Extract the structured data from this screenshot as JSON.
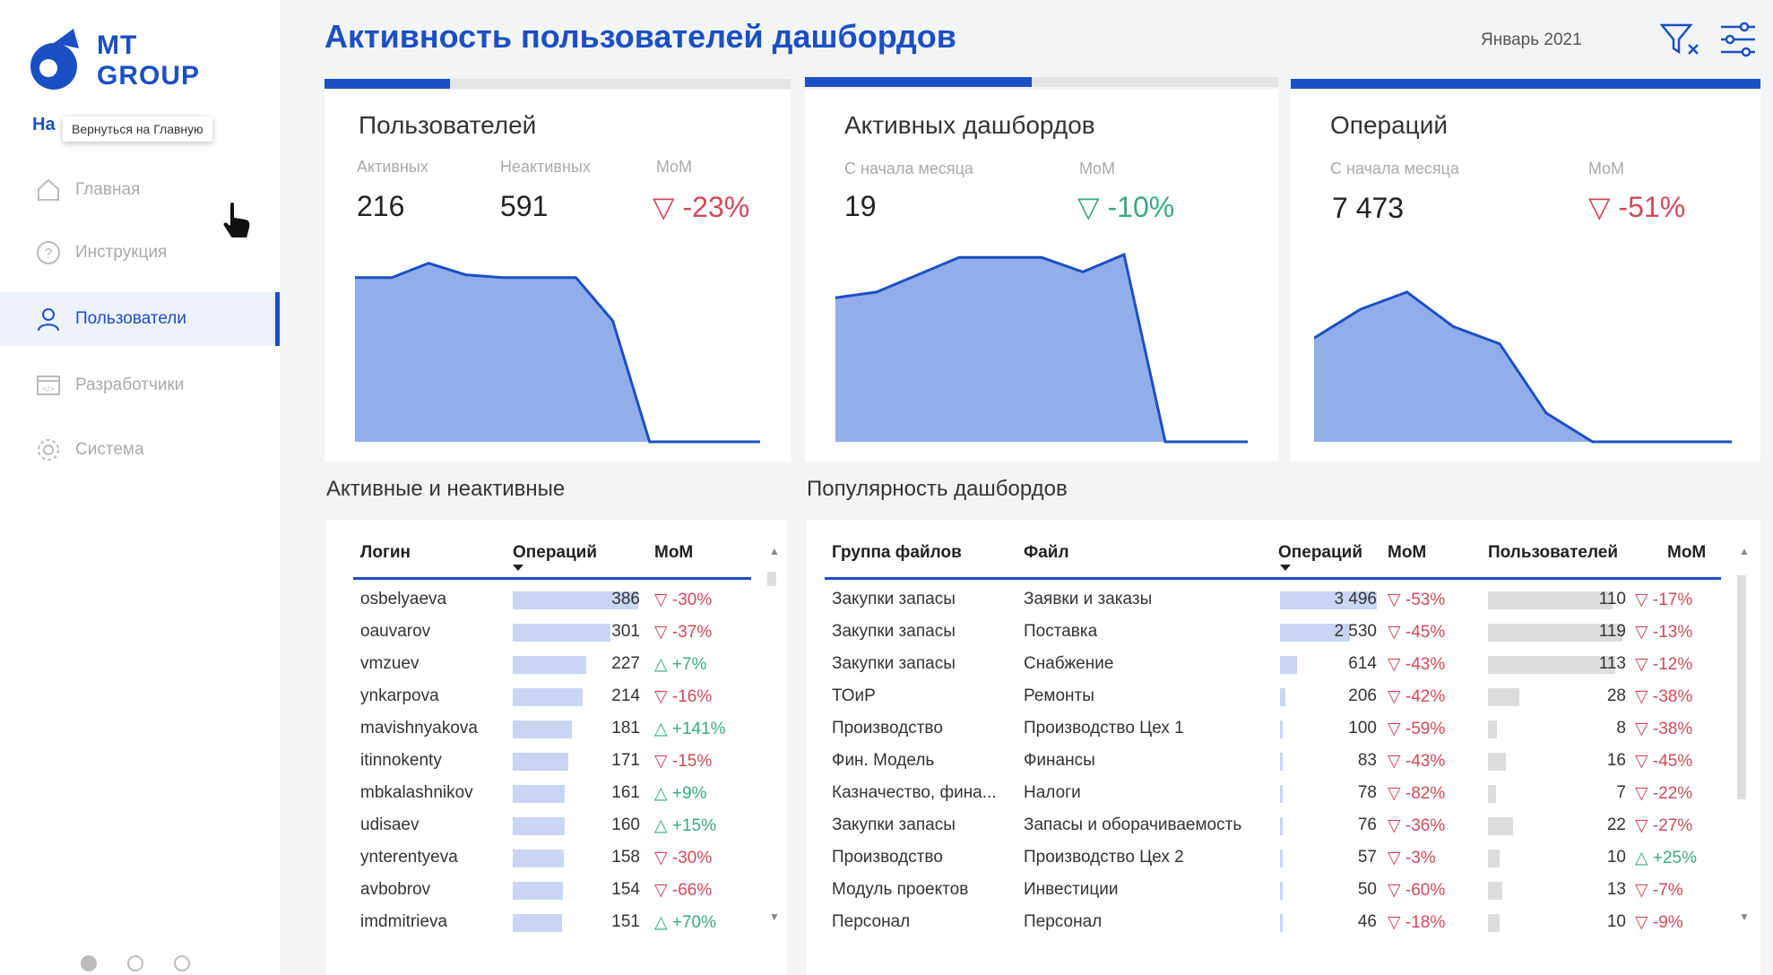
{
  "brand": {
    "line1": "MT",
    "line2": "GROUP",
    "color": "#1b4fc4"
  },
  "sidebar": {
    "home_short": "На",
    "tooltip": "Вернуться на Главную",
    "items": [
      {
        "label": "Главная",
        "icon": "home-icon"
      },
      {
        "label": "Инструкция",
        "icon": "help-icon"
      },
      {
        "label": "Пользователи",
        "icon": "user-icon",
        "active": true
      },
      {
        "label": "Разработчики",
        "icon": "code-icon"
      },
      {
        "label": "Система",
        "icon": "gear-icon"
      }
    ],
    "page_dots": {
      "count": 3,
      "active_index": 0
    }
  },
  "header": {
    "title": "Активность пользователей дашбордов",
    "period": "Январь 2021",
    "icons": [
      "clear-filter-icon",
      "settings-sliders-icon"
    ]
  },
  "cards": [
    {
      "title": "Пользователей",
      "progress": 0.27,
      "labels": [
        "Активных",
        "Неактивных",
        "MoM"
      ],
      "values": [
        "216",
        "591"
      ],
      "mom": "▽ -23%",
      "mom_dir": "down",
      "series": [
        57,
        57,
        62,
        58,
        57,
        57,
        57,
        42,
        0,
        0,
        0,
        0
      ]
    },
    {
      "title": "Активных дашбордов",
      "progress": 0.48,
      "labels": [
        "С начала месяца",
        "MoM"
      ],
      "values": [
        "19"
      ],
      "mom": "▽ -10%",
      "mom_dir": "down",
      "series": [
        50,
        52,
        58,
        64,
        64,
        64,
        59,
        65,
        0,
        0,
        0
      ]
    },
    {
      "title": "Операций",
      "progress": 1.0,
      "labels": [
        "С начала месяца",
        "MoM"
      ],
      "values": [
        "7 473"
      ],
      "mom": "▽ -51%",
      "mom_dir": "down",
      "series": [
        36,
        46,
        52,
        40,
        34,
        10,
        0,
        0,
        0,
        0
      ]
    }
  ],
  "active_table": {
    "title": "Активные и неактивные",
    "columns": [
      "Логин",
      "Операций",
      "MoM"
    ],
    "rows": [
      {
        "login": "osbelyaeva",
        "ops": "386",
        "mom": "▽ -30%",
        "dir": "down"
      },
      {
        "login": "oauvarov",
        "ops": "301",
        "mom": "▽ -37%",
        "dir": "down"
      },
      {
        "login": "vmzuev",
        "ops": "227",
        "mom": "△ +7%",
        "dir": "up"
      },
      {
        "login": "ynkarpova",
        "ops": "214",
        "mom": "▽ -16%",
        "dir": "down"
      },
      {
        "login": "mavishnyakova",
        "ops": "181",
        "mom": "△ +141%",
        "dir": "up"
      },
      {
        "login": "itinnokenty",
        "ops": "171",
        "mom": "▽ -15%",
        "dir": "down"
      },
      {
        "login": "mbkalashnikov",
        "ops": "161",
        "mom": "△ +9%",
        "dir": "up"
      },
      {
        "login": "udisaev",
        "ops": "160",
        "mom": "△ +15%",
        "dir": "up"
      },
      {
        "login": "ynterentyeva",
        "ops": "158",
        "mom": "▽ -30%",
        "dir": "down"
      },
      {
        "login": "avbobrov",
        "ops": "154",
        "mom": "▽ -66%",
        "dir": "down"
      },
      {
        "login": "imdmitrieva",
        "ops": "151",
        "mom": "△ +70%",
        "dir": "up"
      }
    ]
  },
  "popularity_table": {
    "title": "Популярность дашбордов",
    "columns": [
      "Группа файлов",
      "Файл",
      "Операций",
      "MoM",
      "Пользователей",
      "MoM"
    ],
    "rows": [
      {
        "group": "Закупки запасы",
        "file": "Заявки и заказы",
        "ops": "3 496",
        "mom": "▽ -53%",
        "dir": "down",
        "users": "110",
        "umom": "▽ -17%",
        "udir": "down"
      },
      {
        "group": "Закупки запасы",
        "file": "Поставка",
        "ops": "2 530",
        "mom": "▽ -45%",
        "dir": "down",
        "users": "119",
        "umom": "▽ -13%",
        "udir": "down"
      },
      {
        "group": "Закупки запасы",
        "file": "Снабжение",
        "ops": "614",
        "mom": "▽ -43%",
        "dir": "down",
        "users": "113",
        "umom": "▽ -12%",
        "udir": "down"
      },
      {
        "group": "ТОиР",
        "file": "Ремонты",
        "ops": "206",
        "mom": "▽ -42%",
        "dir": "down",
        "users": "28",
        "umom": "▽ -38%",
        "udir": "down"
      },
      {
        "group": "Производство",
        "file": "Производство Цех 1",
        "ops": "100",
        "mom": "▽ -59%",
        "dir": "down",
        "users": "8",
        "umom": "▽ -38%",
        "udir": "down"
      },
      {
        "group": "Фин. Модель",
        "file": "Финансы",
        "ops": "83",
        "mom": "▽ -43%",
        "dir": "down",
        "users": "16",
        "umom": "▽ -45%",
        "udir": "down"
      },
      {
        "group": "Казначество, фина...",
        "file": "Налоги",
        "ops": "78",
        "mom": "▽ -82%",
        "dir": "down",
        "users": "7",
        "umom": "▽ -22%",
        "udir": "down"
      },
      {
        "group": "Закупки запасы",
        "file": "Запасы и оборачиваемость",
        "ops": "76",
        "mom": "▽ -36%",
        "dir": "down",
        "users": "22",
        "umom": "▽ -27%",
        "udir": "down"
      },
      {
        "group": "Производство",
        "file": "Производство Цех 2",
        "ops": "57",
        "mom": "▽ -3%",
        "dir": "down",
        "users": "10",
        "umom": "△ +25%",
        "udir": "up"
      },
      {
        "group": "Модуль проектов",
        "file": "Инвестиции",
        "ops": "50",
        "mom": "▽ -60%",
        "dir": "down",
        "users": "13",
        "umom": "▽ -7%",
        "udir": "down"
      },
      {
        "group": "Персонал",
        "file": "Персонал",
        "ops": "46",
        "mom": "▽ -18%",
        "dir": "down",
        "users": "10",
        "umom": "▽ -9%",
        "udir": "down"
      }
    ]
  },
  "colors": {
    "accent": "#1b4fc4",
    "area_fill": "#92aeea",
    "negative": "#d0495a",
    "positive": "#3aa787"
  }
}
